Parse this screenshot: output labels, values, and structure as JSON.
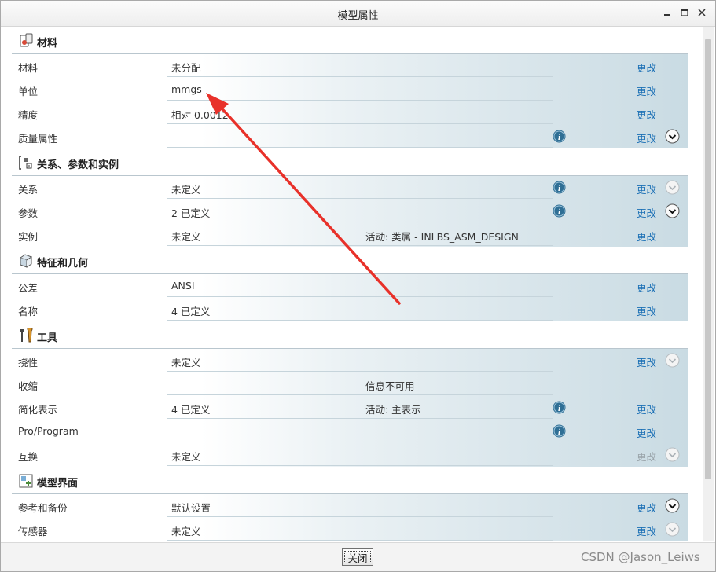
{
  "window": {
    "title": "模型属性"
  },
  "sections": [
    {
      "title": "材料",
      "icon": "material-icon",
      "rows": [
        {
          "name": "材料",
          "value": "未分配",
          "extra": "",
          "info": false,
          "change": "更改",
          "change_enabled": true,
          "chevron": "none"
        },
        {
          "name": "单位",
          "value": "mmgs",
          "extra": "",
          "info": false,
          "change": "更改",
          "change_enabled": true,
          "chevron": "none"
        },
        {
          "name": "精度",
          "value": "相对 0.0012",
          "extra": "",
          "info": false,
          "change": "更改",
          "change_enabled": true,
          "chevron": "none"
        },
        {
          "name": "质量属性",
          "value": "",
          "extra": "",
          "info": true,
          "change": "更改",
          "change_enabled": true,
          "chevron": "active"
        }
      ]
    },
    {
      "title": "关系、参数和实例",
      "icon": "relations-icon",
      "rows": [
        {
          "name": "关系",
          "value": "未定义",
          "extra": "",
          "info": true,
          "change": "更改",
          "change_enabled": true,
          "chevron": "disabled"
        },
        {
          "name": "参数",
          "value": "2 已定义",
          "extra": "",
          "info": true,
          "change": "更改",
          "change_enabled": true,
          "chevron": "active"
        },
        {
          "name": "实例",
          "value": "未定义",
          "extra": "活动: 类属 - INLBS_ASM_DESIGN",
          "info": false,
          "change": "更改",
          "change_enabled": true,
          "chevron": "none"
        }
      ]
    },
    {
      "title": "特征和几何",
      "icon": "feature-geometry-icon",
      "rows": [
        {
          "name": "公差",
          "value": "ANSI",
          "extra": "",
          "info": false,
          "change": "更改",
          "change_enabled": true,
          "chevron": "none"
        },
        {
          "name": "名称",
          "value": "4 已定义",
          "extra": "",
          "info": false,
          "change": "更改",
          "change_enabled": true,
          "chevron": "none"
        }
      ]
    },
    {
      "title": "工具",
      "icon": "tools-icon",
      "rows": [
        {
          "name": "挠性",
          "value": "未定义",
          "extra": "",
          "info": false,
          "change": "更改",
          "change_enabled": true,
          "chevron": "disabled"
        },
        {
          "name": "收缩",
          "value": "",
          "extra": "信息不可用",
          "info": false,
          "change": "",
          "change_enabled": false,
          "chevron": "none"
        },
        {
          "name": "简化表示",
          "value": "4 已定义",
          "extra": "活动: 主表示",
          "info": true,
          "change": "更改",
          "change_enabled": true,
          "chevron": "none"
        },
        {
          "name": "Pro/Program",
          "value": "",
          "extra": "",
          "info": true,
          "change": "更改",
          "change_enabled": true,
          "chevron": "none"
        },
        {
          "name": "互换",
          "value": "未定义",
          "extra": "",
          "info": false,
          "change": "更改",
          "change_enabled": false,
          "chevron": "disabled"
        }
      ]
    },
    {
      "title": "模型界面",
      "icon": "model-interface-icon",
      "rows": [
        {
          "name": "参考和备份",
          "value": "默认设置",
          "extra": "",
          "info": false,
          "change": "更改",
          "change_enabled": true,
          "chevron": "active"
        },
        {
          "name": "传感器",
          "value": "未定义",
          "extra": "",
          "info": false,
          "change": "更改",
          "change_enabled": true,
          "chevron": "disabled"
        }
      ]
    }
  ],
  "footer": {
    "close_label": "关闭"
  },
  "watermark": "CSDN @Jason_Leiws",
  "colors": {
    "link": "#1a6fb5",
    "annotation_arrow": "#e8312a",
    "info_icon": "#2f6f95"
  }
}
